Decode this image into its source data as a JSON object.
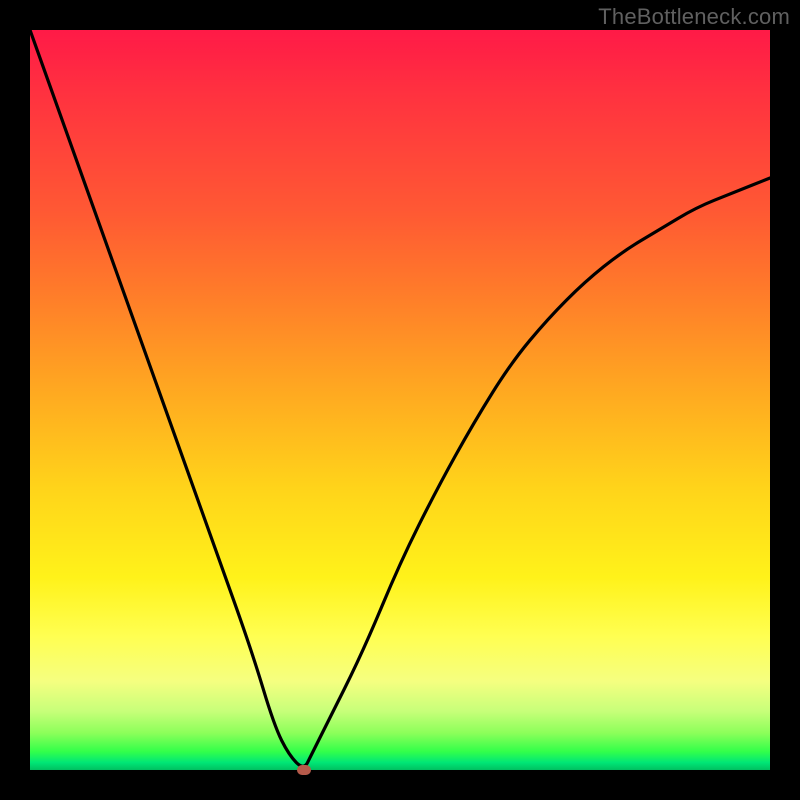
{
  "attribution": "TheBottleneck.com",
  "chart_data": {
    "type": "line",
    "xlabel": "",
    "ylabel": "",
    "xlim": [
      0,
      100
    ],
    "ylim": [
      0,
      100
    ],
    "x_invisible_ticks": true,
    "y_invisible_ticks": true,
    "background_gradient": {
      "orientation": "vertical",
      "stops": [
        {
          "pos": 0.0,
          "color": "#ff1a47"
        },
        {
          "pos": 0.25,
          "color": "#ff5a33"
        },
        {
          "pos": 0.5,
          "color": "#ffb01f"
        },
        {
          "pos": 0.75,
          "color": "#fff21a"
        },
        {
          "pos": 0.92,
          "color": "#c8ff7a"
        },
        {
          "pos": 1.0,
          "color": "#00c060"
        }
      ]
    },
    "series": [
      {
        "name": "bottleneck-curve",
        "color": "#000000",
        "x": [
          0,
          5,
          10,
          15,
          20,
          25,
          30,
          33,
          35,
          37,
          38,
          40,
          45,
          50,
          55,
          60,
          65,
          70,
          75,
          80,
          85,
          90,
          95,
          100
        ],
        "values": [
          100,
          86,
          72,
          58,
          44,
          30,
          16,
          6,
          2,
          0,
          2,
          6,
          16,
          28,
          38,
          47,
          55,
          61,
          66,
          70,
          73,
          76,
          78,
          80
        ]
      }
    ],
    "annotations": [
      {
        "type": "marker",
        "name": "optimal-point",
        "x": 37,
        "y": 0,
        "color": "#b55a4a"
      }
    ],
    "title": "",
    "legend": false,
    "grid": false
  }
}
